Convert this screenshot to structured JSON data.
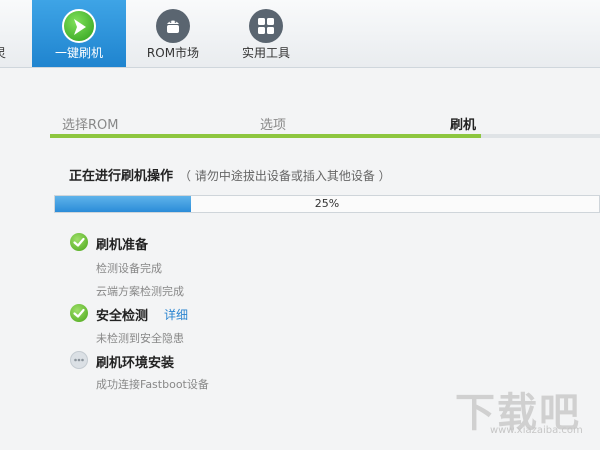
{
  "tabs": [
    {
      "label": "灵",
      "icon": "partial-icon"
    },
    {
      "label": "一键刷机",
      "icon": "flash-play-icon",
      "active": true
    },
    {
      "label": "ROM市场",
      "icon": "android-icon"
    },
    {
      "label": "实用工具",
      "icon": "grid-tools-icon"
    }
  ],
  "steps": {
    "items": [
      "选择ROM",
      "选项",
      "刷机"
    ],
    "current": 2
  },
  "operation": {
    "title": "正在进行刷机操作",
    "hint": "（ 请勿中途拔出设备或插入其他设备 ）",
    "progress_percent": 25,
    "progress_label": "25%"
  },
  "checklist": [
    {
      "title": "刷机准备",
      "status": "done",
      "subs": [
        "检测设备完成",
        "云端方案检测完成"
      ]
    },
    {
      "title": "安全检测",
      "status": "done",
      "detail_link": "详细",
      "subs": [
        "未检测到安全隐患"
      ]
    },
    {
      "title": "刷机环境安装",
      "status": "pending",
      "subs": [
        "成功连接Fastboot设备"
      ]
    }
  ],
  "watermark": {
    "big": "下载吧",
    "small": "www.xiazaiba.com"
  },
  "colors": {
    "accent": "#1f84cf",
    "progress_green": "#8dc63f",
    "check_green": "#4aa519",
    "link": "#2a84d0"
  }
}
